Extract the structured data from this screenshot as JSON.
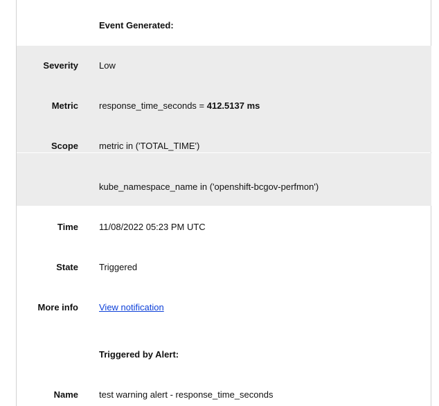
{
  "event": {
    "heading": "Event Generated:",
    "severity": {
      "label": "Severity",
      "value": "Low"
    },
    "metric": {
      "label": "Metric",
      "prefix": "response_time_seconds = ",
      "value": "412.5137 ms"
    },
    "scope": {
      "label": "Scope",
      "value_line1": "metric in ('TOTAL_TIME')",
      "value_line2": "kube_namespace_name in ('openshift-bcgov-perfmon')"
    },
    "time": {
      "label": "Time",
      "value": "11/08/2022 05:23 PM UTC"
    },
    "state": {
      "label": "State",
      "value": "Triggered"
    },
    "more_info": {
      "label": "More info",
      "link_text": "View notification"
    }
  },
  "alert": {
    "heading": "Triggered by Alert:",
    "name": {
      "label": "Name",
      "value": "test warning alert - response_time_seconds"
    }
  },
  "colors": {
    "shaded_row": "#ececec",
    "link": "#0b3fd8",
    "border": "#d2d2d2"
  }
}
